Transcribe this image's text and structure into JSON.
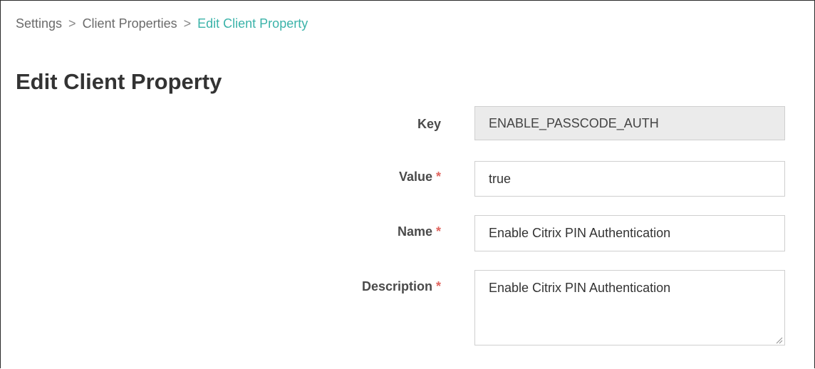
{
  "breadcrumb": {
    "items": [
      "Settings",
      "Client Properties"
    ],
    "separator": ">",
    "current": "Edit Client Property"
  },
  "page": {
    "title": "Edit Client Property"
  },
  "form": {
    "required_marker": "*",
    "key": {
      "label": "Key",
      "value": "ENABLE_PASSCODE_AUTH",
      "readonly": true
    },
    "value": {
      "label": "Value",
      "value": "true",
      "required": true
    },
    "name": {
      "label": "Name",
      "value": "Enable Citrix PIN Authentication",
      "required": true
    },
    "description": {
      "label": "Description",
      "value": "Enable Citrix PIN Authentication",
      "required": true
    }
  },
  "colors": {
    "breadcrumb_current": "#3bb3a9",
    "required_asterisk": "#e0655f",
    "readonly_field_bg": "#ebebeb"
  },
  "icons": {
    "textarea_resize": "resize-grip-icon"
  }
}
